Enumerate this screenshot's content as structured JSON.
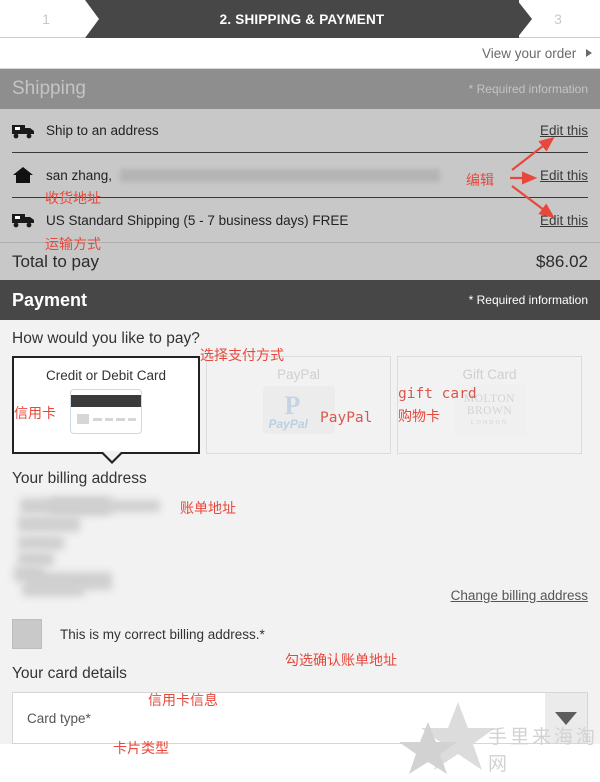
{
  "steps": {
    "step1": "1",
    "step2": "2. SHIPPING & PAYMENT",
    "step3": "3"
  },
  "view_order": {
    "label": "View your order"
  },
  "shipping": {
    "title": "Shipping",
    "required_note": "* Required information",
    "rows": [
      {
        "text": "Ship to an address",
        "edit": "Edit this",
        "icon": "truck-icon"
      },
      {
        "text": "san zhang,",
        "edit": "Edit this",
        "icon": "home-icon"
      },
      {
        "text": "US Standard Shipping (5 - 7 business days)  FREE",
        "edit": "Edit this",
        "icon": "truck-icon"
      }
    ],
    "total_label": "Total to pay",
    "total_value": "$86.02"
  },
  "payment": {
    "title": "Payment",
    "required_note": "* Required information",
    "how_pay": "How would you like to pay?",
    "methods": [
      {
        "label": "Credit or Debit Card",
        "icon": "credit-card-icon",
        "selected": true
      },
      {
        "label": "PayPal",
        "icon": "paypal-logo",
        "selected": false
      },
      {
        "label": "Gift Card",
        "icon": "molton-brown-giftcard-logo",
        "selected": false
      }
    ],
    "giftcard_brand_line1": "MOLTON",
    "giftcard_brand_line2": "BROWN",
    "giftcard_brand_line3": "LONDON",
    "paypal_word": "PayPal",
    "billing_title": "Your billing address",
    "change_billing": "Change billing address",
    "confirm_checkbox_label": "This is my correct billing address.*",
    "card_details_title": "Your card details",
    "card_type_label": "Card type*"
  },
  "annotations": {
    "edit": "编辑",
    "ship_address": "收货地址",
    "ship_method": "运输方式",
    "choose_payment": "选择支付方式",
    "credit_card": "信用卡",
    "paypal": "PayPal",
    "gift_card_mono": "gift card",
    "gift_card_cn": "购物卡",
    "billing_address": "账单地址",
    "confirm_billing": "勾选确认账单地址",
    "card_info": "信用卡信息",
    "card_type": "卡片类型"
  },
  "watermark": {
    "text": "手里来海淘网"
  },
  "colors": {
    "accent_red": "#e8483c",
    "header_dark": "#474747",
    "header_gray": "#8e8e8e",
    "shipping_bg": "#c8c8c8",
    "payment_bg": "#f2f2f2"
  }
}
